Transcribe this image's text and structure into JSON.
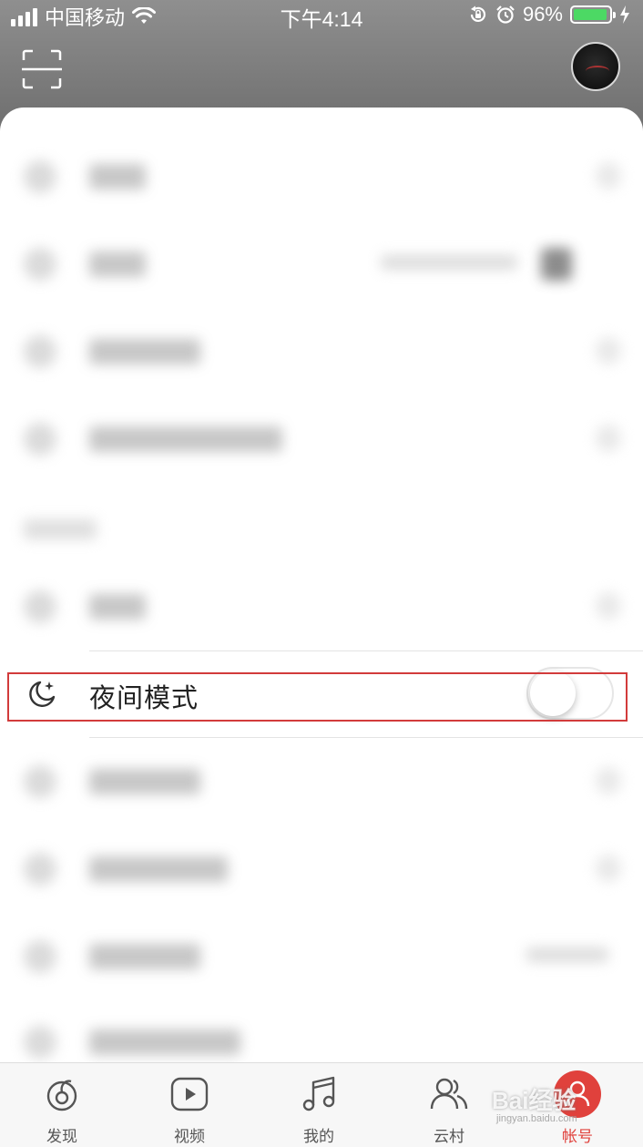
{
  "status_bar": {
    "carrier": "中国移动",
    "time": "下午4:14",
    "battery_percent": "96%",
    "battery_level": 0.96,
    "battery_color": "#4cd964"
  },
  "header": {
    "scan_icon": "scan-icon",
    "avatar": "avatar"
  },
  "settings": {
    "night_mode": {
      "label": "夜间模式",
      "icon": "moon-icon",
      "enabled": false
    }
  },
  "tabbar": {
    "items": [
      {
        "label": "发现",
        "icon": "discover-icon"
      },
      {
        "label": "视频",
        "icon": "video-icon"
      },
      {
        "label": "我的",
        "icon": "music-note-icon"
      },
      {
        "label": "云村",
        "icon": "friends-icon"
      },
      {
        "label": "帐号",
        "icon": "account-icon",
        "active": true
      }
    ],
    "active_color": "#e0413c"
  },
  "highlight_color": "#d23b3b",
  "watermark": {
    "text": "Bai经验",
    "url": "jingyan.baidu.com"
  }
}
